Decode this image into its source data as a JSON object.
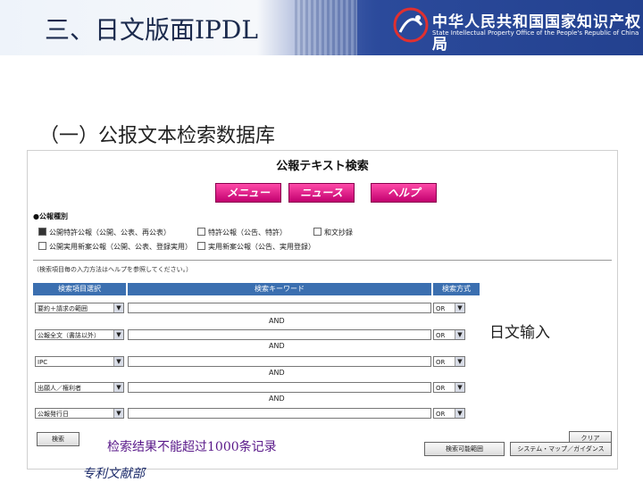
{
  "slide": {
    "title": "三、日文版面IPDL",
    "section_title": "（一）公报文本检索数据库",
    "annotation_input": "日文输入",
    "annotation_limit": "检索结果不能超过1000条记录",
    "footer_label": "专利文献部"
  },
  "header": {
    "org_name_cn": "中华人民共和国国家知识产权局",
    "org_name_en": "State Intellectual Property Office of the People's Republic of China",
    "logo_icon": "sipo-logo-icon"
  },
  "panel": {
    "title": "公報テキスト検索",
    "nav": {
      "menu": "メニュー",
      "news": "ニュース",
      "help": "ヘルプ"
    },
    "category_label": "●公報種別",
    "checkboxes": [
      {
        "label": "公開特許公報（公開、公表、再公表）",
        "checked": true
      },
      {
        "label": "特許公報（公告、特許）",
        "checked": false
      },
      {
        "label": "和文抄録",
        "checked": false
      },
      {
        "label": "公開実用新案公報（公開、公表、登録実用）",
        "checked": false
      },
      {
        "label": "実用新案公報（公告、実用登録）",
        "checked": false
      }
    ],
    "hint": "（検索項目毎の入力方法はヘルプを参照してください。）",
    "columns": {
      "field": "検索項目選択",
      "keyword": "検索キーワード",
      "method": "検索方式"
    },
    "rows": [
      {
        "field": "要約＋請求の範囲",
        "method": "OR"
      },
      {
        "field": "公報全文（書誌以外）",
        "method": "OR"
      },
      {
        "field": "IPC",
        "method": "OR"
      },
      {
        "field": "出願人／権利者",
        "method": "OR"
      },
      {
        "field": "公報発行日",
        "method": "OR"
      }
    ],
    "connector": "AND",
    "buttons": {
      "search": "検索",
      "clear": "クリア",
      "count": "検索可能範囲",
      "guidance": "システム・マップ／ガイダンス"
    }
  }
}
